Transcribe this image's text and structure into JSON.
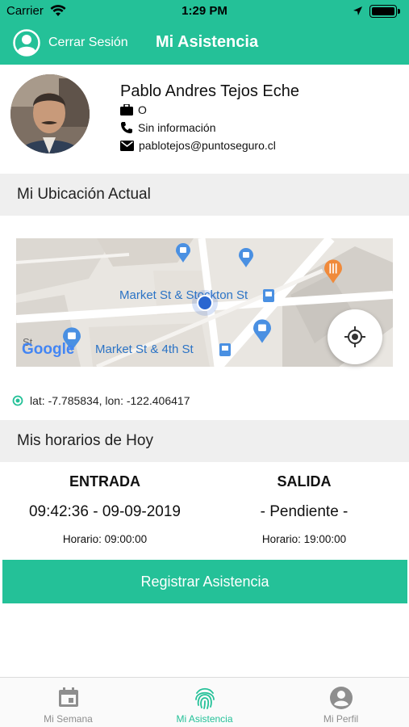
{
  "status_bar": {
    "carrier": "Carrier",
    "time": "1:29 PM"
  },
  "navbar": {
    "logout_label": "Cerrar Sesión",
    "title": "Mi Asistencia"
  },
  "profile": {
    "name": "Pablo Andres Tejos Eche",
    "role": "O",
    "phone": "Sin información",
    "email": "pablotejos@puntoseguro.cl"
  },
  "location_section": {
    "title": "Mi Ubicación Actual"
  },
  "map": {
    "labels": [
      "Market St & Stockton St",
      "Market St & 4th St",
      "Google",
      "St"
    ]
  },
  "coordinates": "lat: -7.785834, lon: -122.406417",
  "schedule_section": {
    "title": "Mis horarios de Hoy"
  },
  "schedule": {
    "entry": {
      "header": "ENTRADA",
      "value": "09:42:36 - 09-09-2019",
      "scheduled": "Horario: 09:00:00"
    },
    "exit": {
      "header": "SALIDA",
      "value": "- Pendiente -",
      "scheduled": "Horario: 19:00:00"
    }
  },
  "register_button": "Registrar Asistencia",
  "tabs": [
    {
      "label": "Mi Semana",
      "icon": "calendar-icon",
      "active": false
    },
    {
      "label": "Mi Asistencia",
      "icon": "fingerprint-icon",
      "active": true
    },
    {
      "label": "Mi Perfil",
      "icon": "account-circle-icon",
      "active": false
    }
  ],
  "colors": {
    "accent": "#24c198",
    "header_bg": "#efefef",
    "inactive": "#8e8e8e"
  }
}
